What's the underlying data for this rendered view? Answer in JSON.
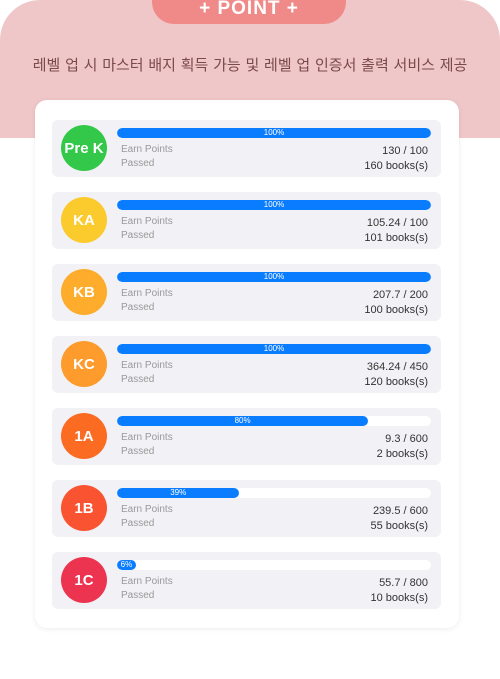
{
  "header": {
    "badge": "+ POINT +",
    "subtitle": "레벨 업 시  마스터 배지 획득 가능 및 레벨 업 인증서 출력 서비스 제공"
  },
  "labels": {
    "earn": "Earn Points",
    "passed": "Passed"
  },
  "levels": [
    {
      "name": "Pre K",
      "color": "#34c84a",
      "percent": 100,
      "percent_label": "100%",
      "points": "130 / 100",
      "books": "160 books(s)"
    },
    {
      "name": "KA",
      "color": "#fbca2c",
      "percent": 100,
      "percent_label": "100%",
      "points": "105.24 / 100",
      "books": "101 books(s)"
    },
    {
      "name": "KB",
      "color": "#fdac2c",
      "percent": 100,
      "percent_label": "100%",
      "points": "207.7 / 200",
      "books": "100 books(s)"
    },
    {
      "name": "KC",
      "color": "#fd9b2d",
      "percent": 100,
      "percent_label": "100%",
      "points": "364.24 / 450",
      "books": "120 books(s)"
    },
    {
      "name": "1A",
      "color": "#fb6c22",
      "percent": 80,
      "percent_label": "80%",
      "points": "9.3 / 600",
      "books": "2 books(s)"
    },
    {
      "name": "1B",
      "color": "#fa5331",
      "percent": 39,
      "percent_label": "39%",
      "points": "239.5 / 600",
      "books": "55 books(s)"
    },
    {
      "name": "1C",
      "color": "#ec3350",
      "percent": 6,
      "percent_label": "6%",
      "points": "55.7 / 800",
      "books": "10 books(s)"
    }
  ]
}
